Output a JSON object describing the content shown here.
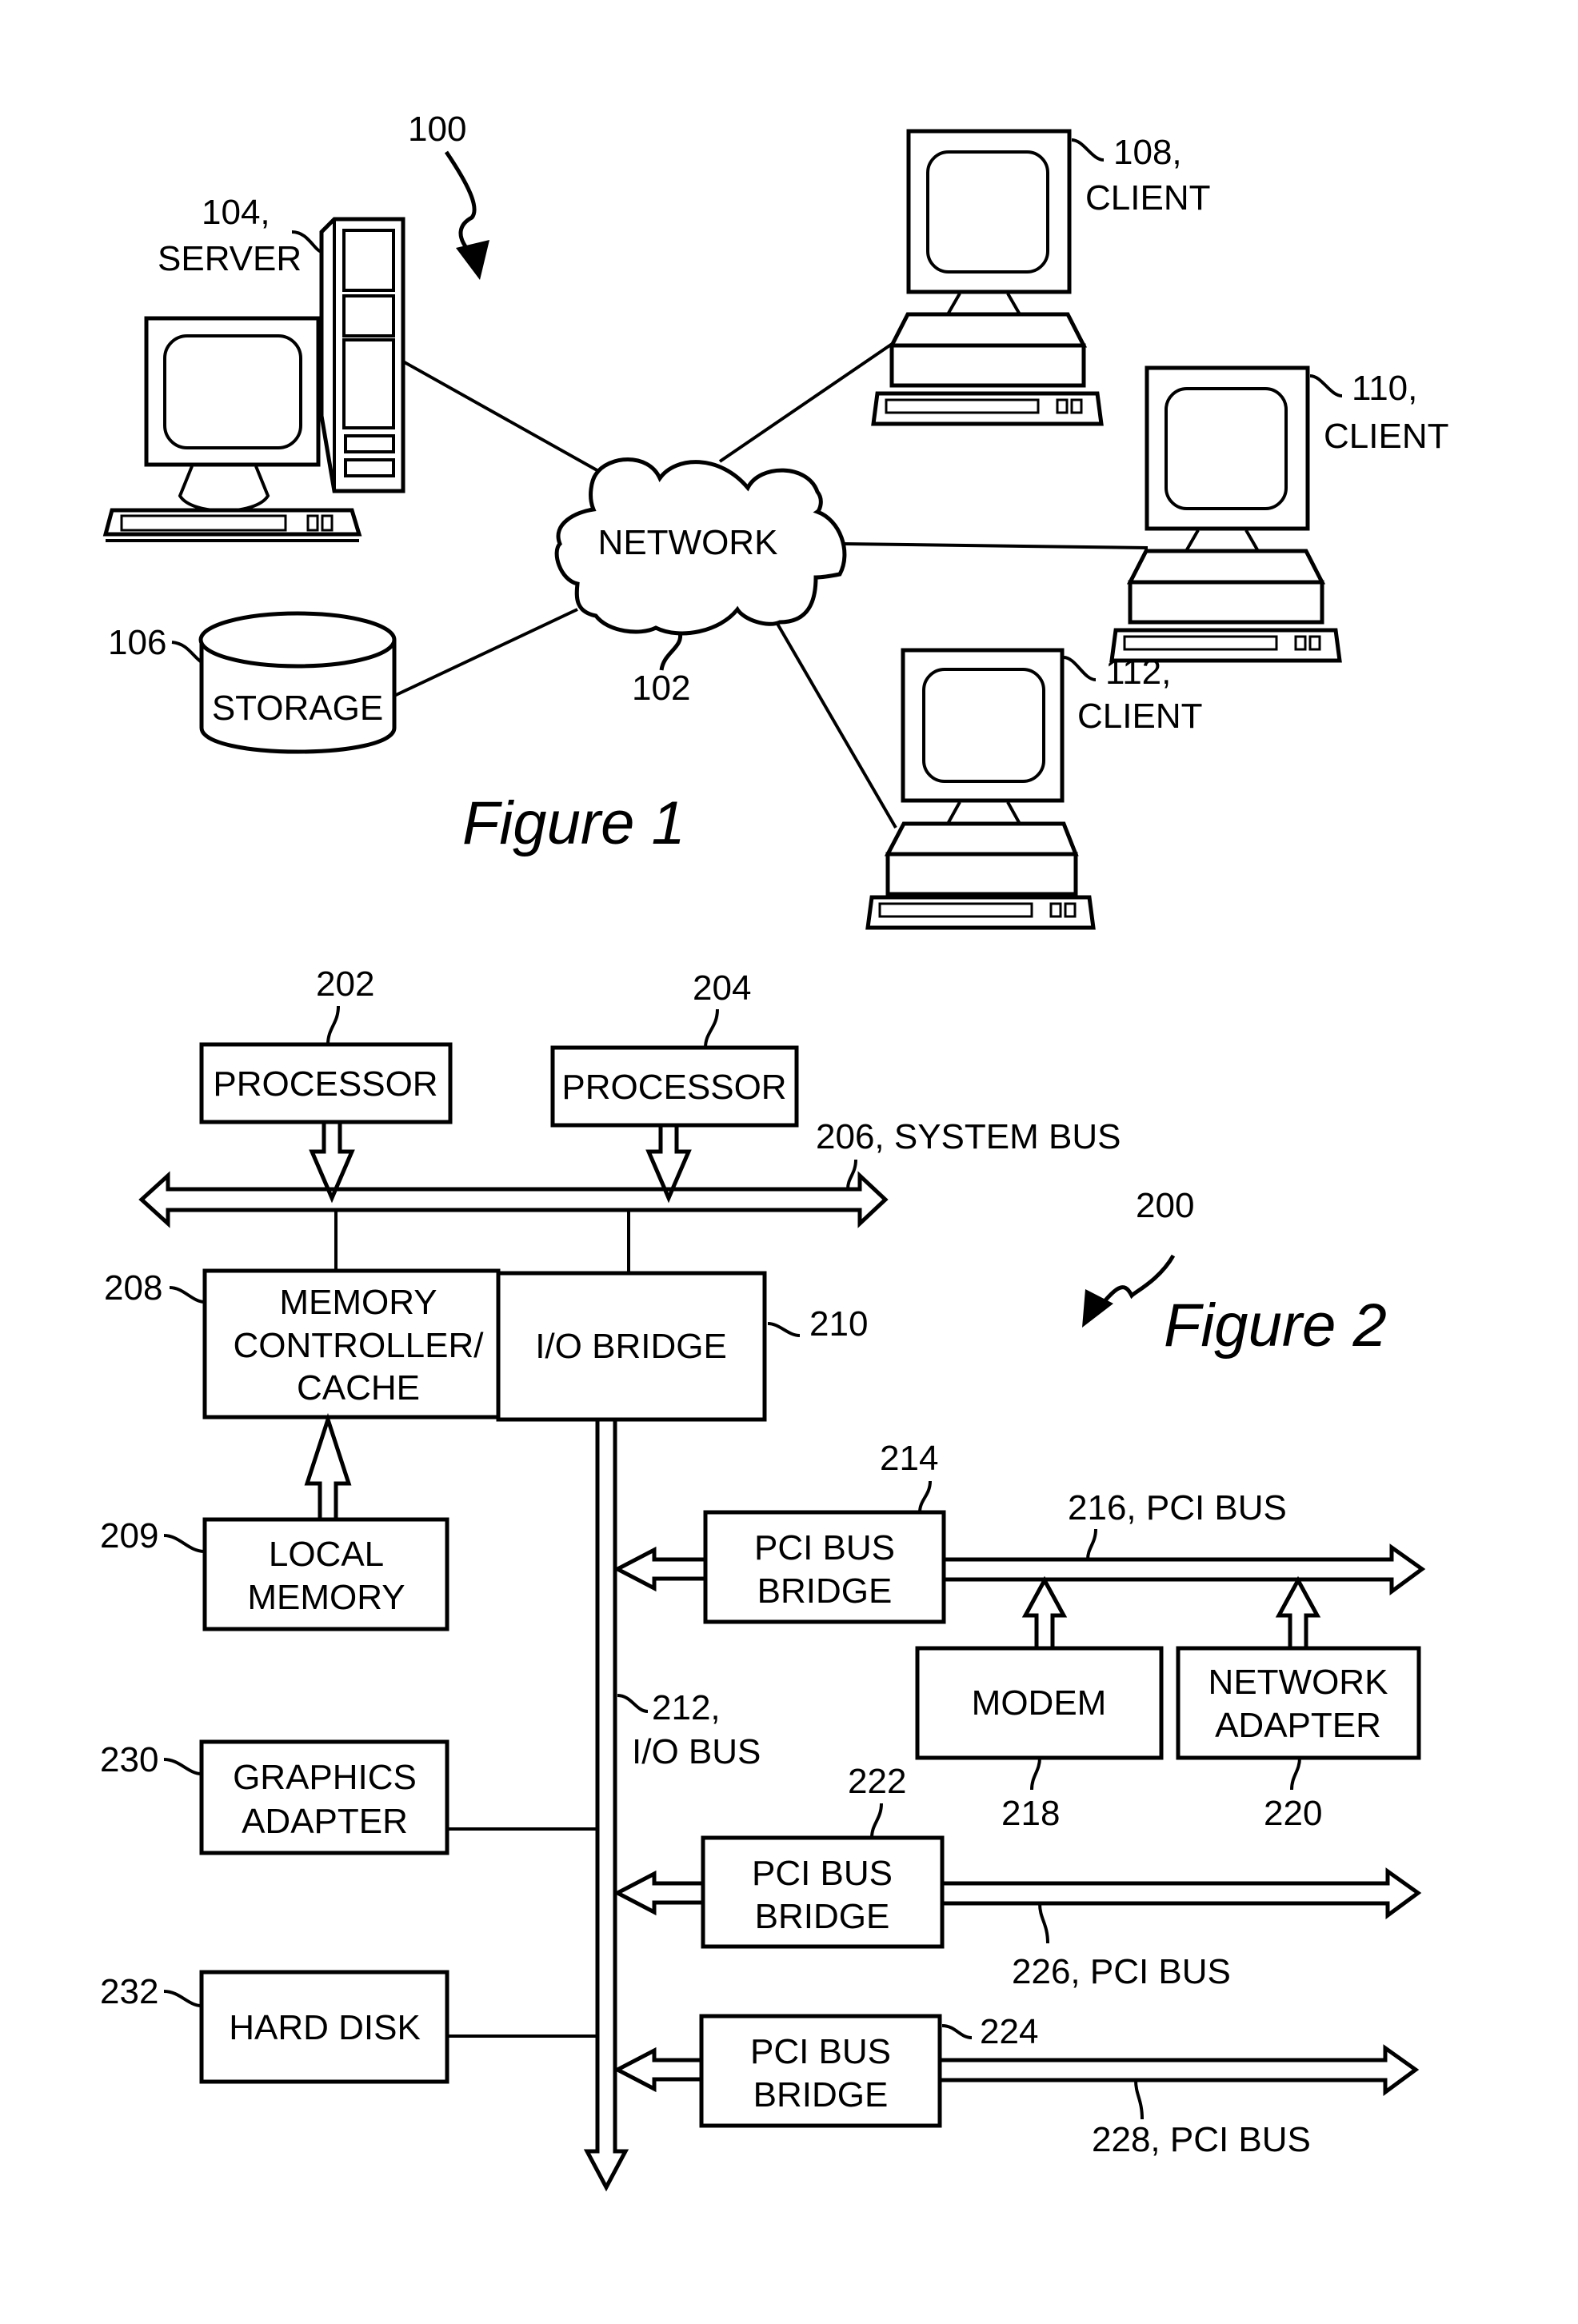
{
  "figure1": {
    "caption": "Figure 1",
    "system_ref": "100",
    "network": {
      "label": "NETWORK",
      "ref": "102"
    },
    "server": {
      "ref": "104,",
      "label": "SERVER"
    },
    "storage": {
      "ref": "106",
      "label": "STORAGE"
    },
    "clients": [
      {
        "ref": "108,",
        "label": "CLIENT"
      },
      {
        "ref": "110,",
        "label": "CLIENT"
      },
      {
        "ref": "112,",
        "label": "CLIENT"
      }
    ]
  },
  "figure2": {
    "caption": "Figure 2",
    "system_ref": "200",
    "processors": [
      {
        "ref": "202",
        "label": "PROCESSOR"
      },
      {
        "ref": "204",
        "label": "PROCESSOR"
      }
    ],
    "system_bus": {
      "label": "206, SYSTEM BUS"
    },
    "memory_controller": {
      "ref": "208",
      "lines": [
        "MEMORY",
        "CONTROLLER/",
        "CACHE"
      ]
    },
    "io_bridge": {
      "ref": "210",
      "label": "I/O BRIDGE"
    },
    "local_memory": {
      "ref": "209",
      "lines": [
        "LOCAL",
        "MEMORY"
      ]
    },
    "io_bus": {
      "ref": "212,",
      "label": "I/O BUS"
    },
    "graphics_adapter": {
      "ref": "230",
      "lines": [
        "GRAPHICS",
        "ADAPTER"
      ]
    },
    "hard_disk": {
      "ref": "232",
      "label": "HARD DISK"
    },
    "pci_bridges": [
      {
        "ref": "214",
        "lines": [
          "PCI BUS",
          "BRIDGE"
        ],
        "bus_label": "216, PCI BUS"
      },
      {
        "ref": "222",
        "lines": [
          "PCI BUS",
          "BRIDGE"
        ],
        "bus_label": "226, PCI BUS"
      },
      {
        "ref": "224",
        "lines": [
          "PCI BUS",
          "BRIDGE"
        ],
        "bus_label": "228, PCI BUS"
      }
    ],
    "modem": {
      "ref": "218",
      "label": "MODEM"
    },
    "network_adapter": {
      "ref": "220",
      "lines": [
        "NETWORK",
        "ADAPTER"
      ]
    }
  }
}
